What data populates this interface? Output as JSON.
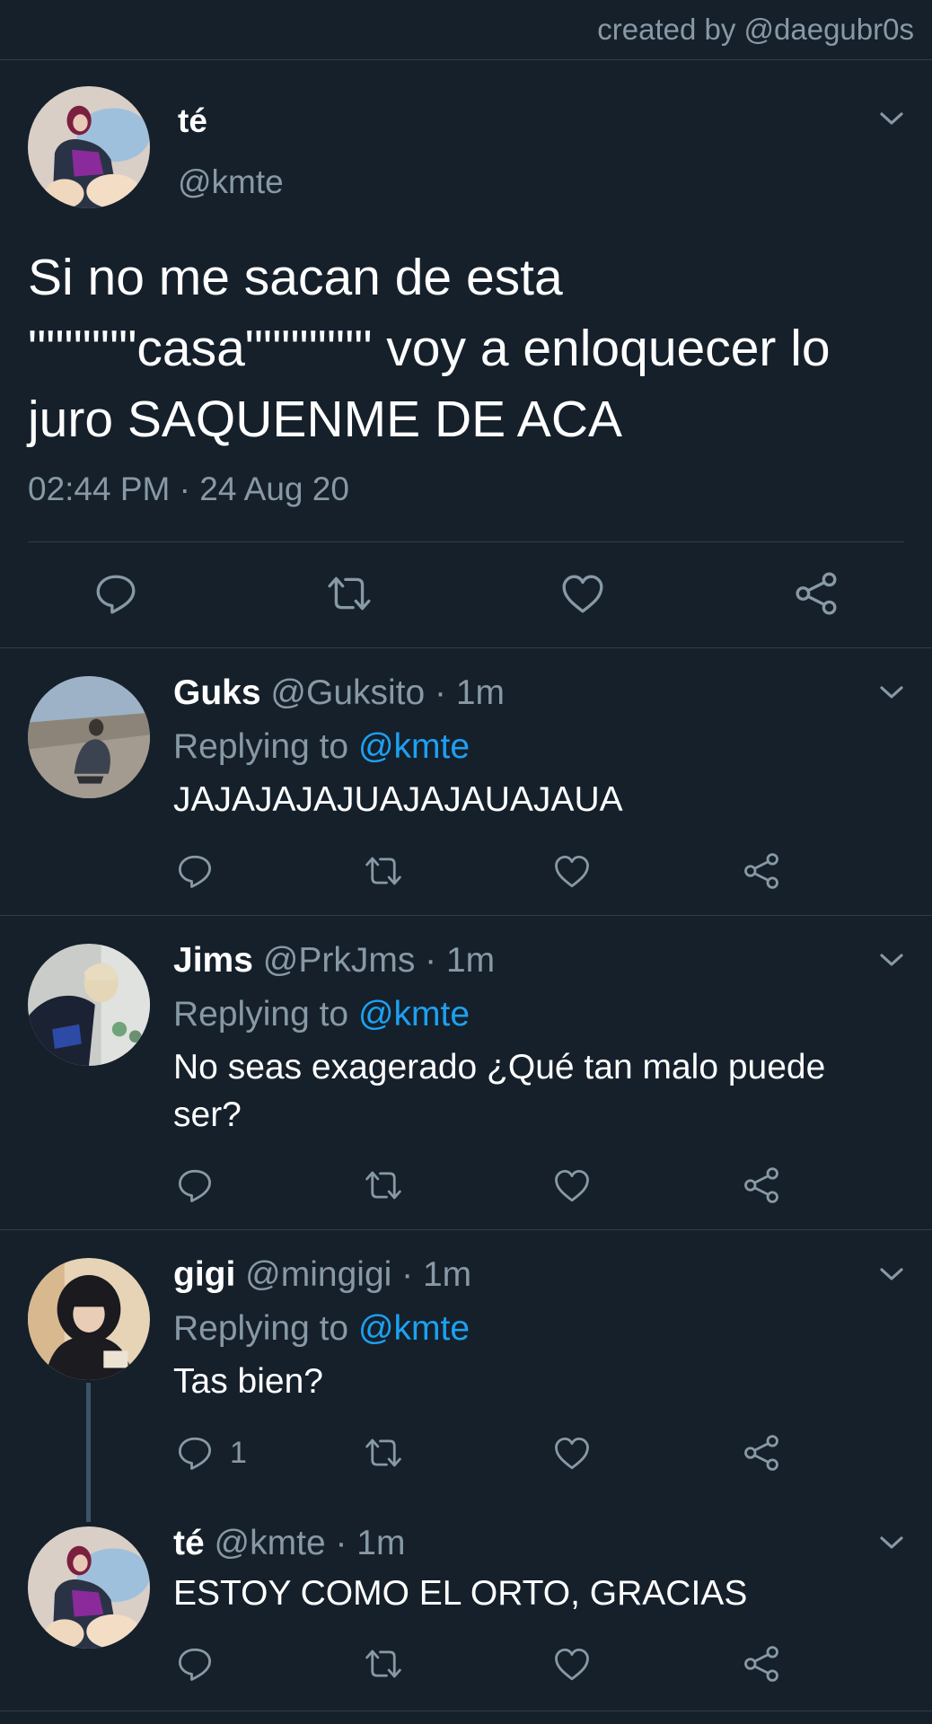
{
  "credit": "created by @daegubr0s",
  "main_tweet": {
    "name": "té",
    "handle": "@kmte",
    "text": "Si no me sacan de esta \"\"\"\"\"\"casa\"\"\"\"\"\"\" voy a enloquecer lo juro SAQUENME DE ACA",
    "timestamp": "02:44 PM · 24 Aug 20",
    "avatar_icon": "profile-photo"
  },
  "replies": [
    {
      "name": "Guks",
      "handle": "@Guksito · 1m",
      "replying_label": "Replying to",
      "replying_to": "@kmte",
      "text": "JAJAJAJAJUAJAJAUAJAUA",
      "reply_count": ""
    },
    {
      "name": "Jims",
      "handle": "@PrkJms · 1m",
      "replying_label": "Replying to",
      "replying_to": "@kmte",
      "text": "No seas exagerado ¿Qué tan malo puede ser?",
      "reply_count": ""
    },
    {
      "name": "gigi",
      "handle": "@mingigi · 1m",
      "replying_label": "Replying to",
      "replying_to": "@kmte",
      "text": "Tas bien?",
      "reply_count": "1"
    },
    {
      "name": "té",
      "handle": "@kmte · 1m",
      "text": "ESTOY COMO EL ORTO, GRACIAS",
      "reply_count": ""
    }
  ],
  "colors": {
    "background": "#15202b",
    "secondary_text": "#8899a6",
    "mention": "#1da1f2",
    "divider": "#2f3c4a"
  },
  "icons": [
    "reply-icon",
    "retweet-icon",
    "like-icon",
    "share-icon",
    "chevron-down-icon"
  ]
}
